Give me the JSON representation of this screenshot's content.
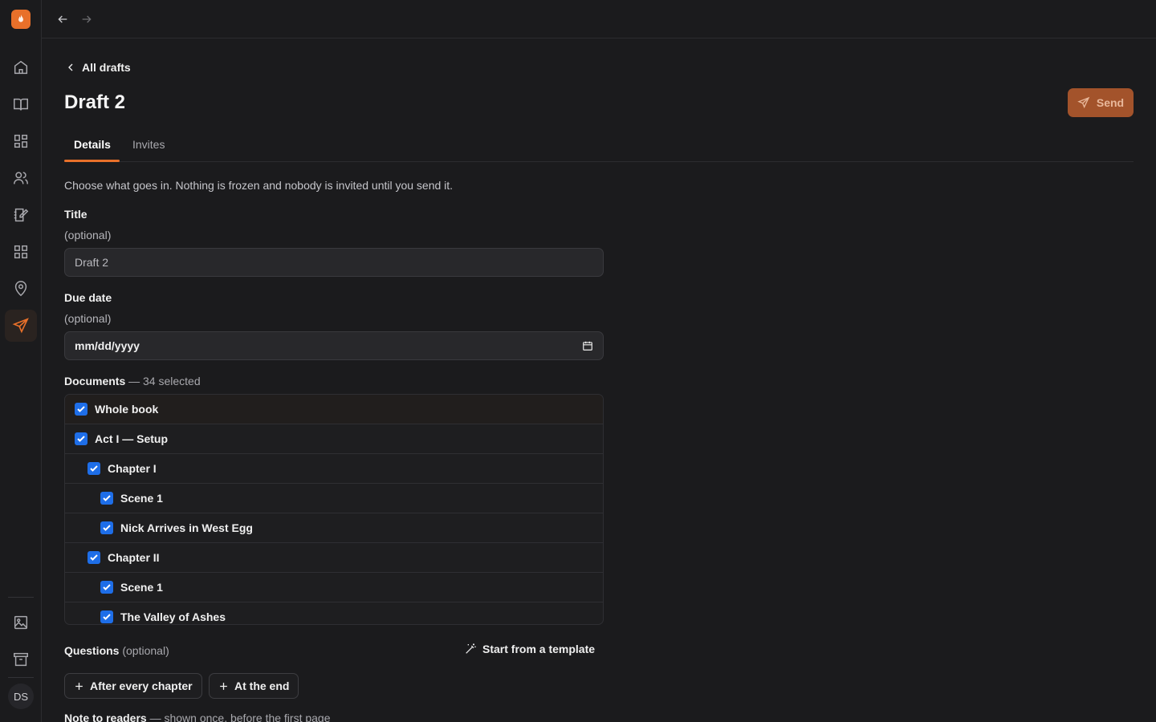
{
  "sidebar": {
    "logo_icon": "flame-icon",
    "items": [
      {
        "icon": "home-icon",
        "active": false
      },
      {
        "icon": "book-open-icon",
        "active": false
      },
      {
        "icon": "dashboard-grid-icon",
        "active": false
      },
      {
        "icon": "users-icon",
        "active": false
      },
      {
        "icon": "edit-notebook-icon",
        "active": false
      },
      {
        "icon": "apps-grid-icon",
        "active": false
      },
      {
        "icon": "map-pin-icon",
        "active": false
      },
      {
        "icon": "send-icon",
        "active": true
      }
    ],
    "bottom_items": [
      {
        "icon": "image-icon"
      },
      {
        "icon": "archive-icon"
      }
    ],
    "avatar_initials": "DS",
    "accent_color": "#e8702a"
  },
  "topbar": {
    "back_icon": "arrow-left-icon",
    "forward_icon": "arrow-right-icon"
  },
  "header": {
    "back_label": "All drafts",
    "title": "Draft 2",
    "send_label": "Send"
  },
  "tabs": [
    {
      "label": "Details",
      "active": true
    },
    {
      "label": "Invites",
      "active": false
    }
  ],
  "form": {
    "intro": "Choose what goes in. Nothing is frozen and nobody is invited until you send it.",
    "title_label": "Title",
    "title_hint": "(optional)",
    "title_value": "Draft 2",
    "due_label": "Due date",
    "due_hint": "(optional)",
    "due_placeholder": "mm/dd/yyyy",
    "documents_label": "Documents",
    "documents_count": "— 34 selected",
    "documents": [
      {
        "label": "Whole book",
        "level": 0,
        "checked": true
      },
      {
        "label": "Act I — Setup",
        "level": 0,
        "checked": true
      },
      {
        "label": "Chapter I",
        "level": 1,
        "checked": true
      },
      {
        "label": "Scene 1",
        "level": 2,
        "checked": true
      },
      {
        "label": "Nick Arrives in West Egg",
        "level": 2,
        "checked": true
      },
      {
        "label": "Chapter II",
        "level": 1,
        "checked": true
      },
      {
        "label": "Scene 1",
        "level": 2,
        "checked": true
      },
      {
        "label": "The Valley of Ashes",
        "level": 2,
        "checked": true
      }
    ],
    "questions_label": "Questions",
    "questions_hint": "(optional)",
    "template_label": "Start from a template",
    "after_chapter_label": "After every chapter",
    "at_end_label": "At the end",
    "note_label": "Note to readers",
    "note_hint": "— shown once, before the first page"
  }
}
